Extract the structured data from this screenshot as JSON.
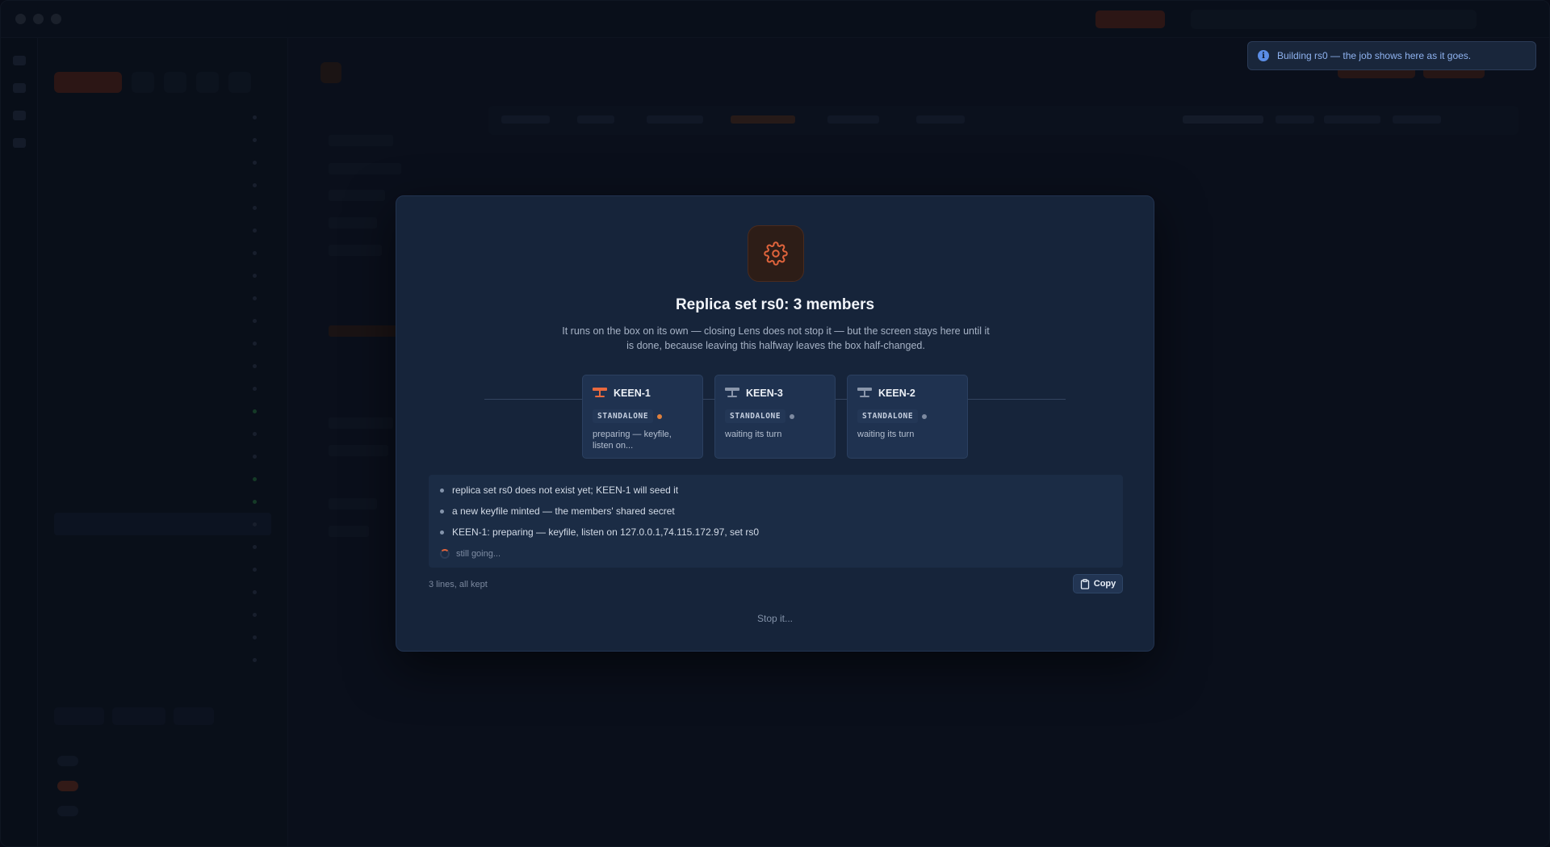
{
  "toast": {
    "message": "Building rs0 — the job shows here as it goes."
  },
  "modal": {
    "title": "Replica set rs0: 3 members",
    "description": "It runs on the box on its own — closing Lens does not stop it — but the screen stays here until it is done, because leaving this halfway leaves the box half-changed.",
    "members": [
      {
        "name": "KEEN-1",
        "role": "STANDALONE",
        "status": "preparing — keyfile, listen on...",
        "state_color": "#e0803c",
        "icon_color": "#e8693e"
      },
      {
        "name": "KEEN-3",
        "role": "STANDALONE",
        "status": "waiting its turn",
        "state_color": "#7d8aa0",
        "icon_color": "#8a96ab"
      },
      {
        "name": "KEEN-2",
        "role": "STANDALONE",
        "status": "waiting its turn",
        "state_color": "#7d8aa0",
        "icon_color": "#8a96ab"
      }
    ],
    "log": {
      "lines": [
        "replica set rs0 does not exist yet; KEEN-1 will seed it",
        "a new keyfile minted — the members' shared secret",
        "KEEN-1: preparing — keyfile, listen on 127.0.0.1,74.115.172.97, set rs0"
      ],
      "still_going": "still going..."
    },
    "lines_note": "3 lines, all kept",
    "copy_label": "Copy",
    "stop_label": "Stop it..."
  },
  "colors": {
    "accent": "#e0643c",
    "info": "#5b8de6"
  }
}
